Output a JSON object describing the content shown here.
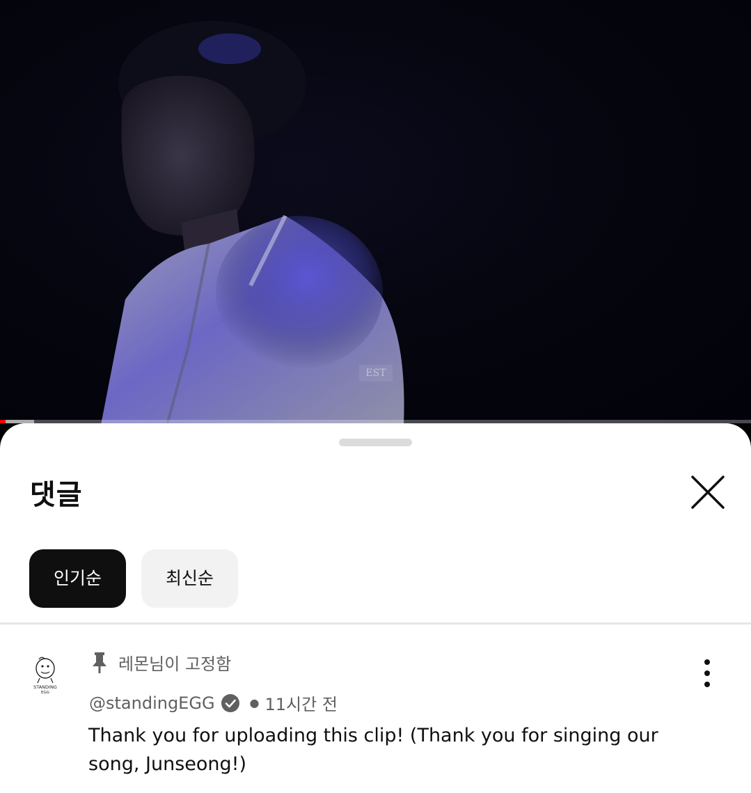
{
  "video": {
    "watermark": "EST",
    "progress_played_fraction": 0.007,
    "progress_buffered_fraction": 0.045
  },
  "sheet": {
    "title": "댓글",
    "close_icon": "close-icon",
    "sort_chips": [
      {
        "label": "인기순",
        "selected": true
      },
      {
        "label": "최신순",
        "selected": false
      }
    ]
  },
  "comment": {
    "pinned_label": "레몬님이 고정함",
    "pin_icon": "pin-icon",
    "author": "@standingEGG",
    "verified_icon": "verified-check-icon",
    "time": "11시간 전",
    "text": "Thank you for uploading this clip! (Thank you for singing our song, Junseong!)",
    "avatar_text_1": "STANDING",
    "avatar_text_2": "EGG",
    "more_icon": "more-vert-icon"
  },
  "colors": {
    "progress_red": "#ff0000",
    "chip_active_bg": "#0f0f0f",
    "chip_inactive_bg": "#f2f2f2",
    "secondary_text": "#606060"
  }
}
